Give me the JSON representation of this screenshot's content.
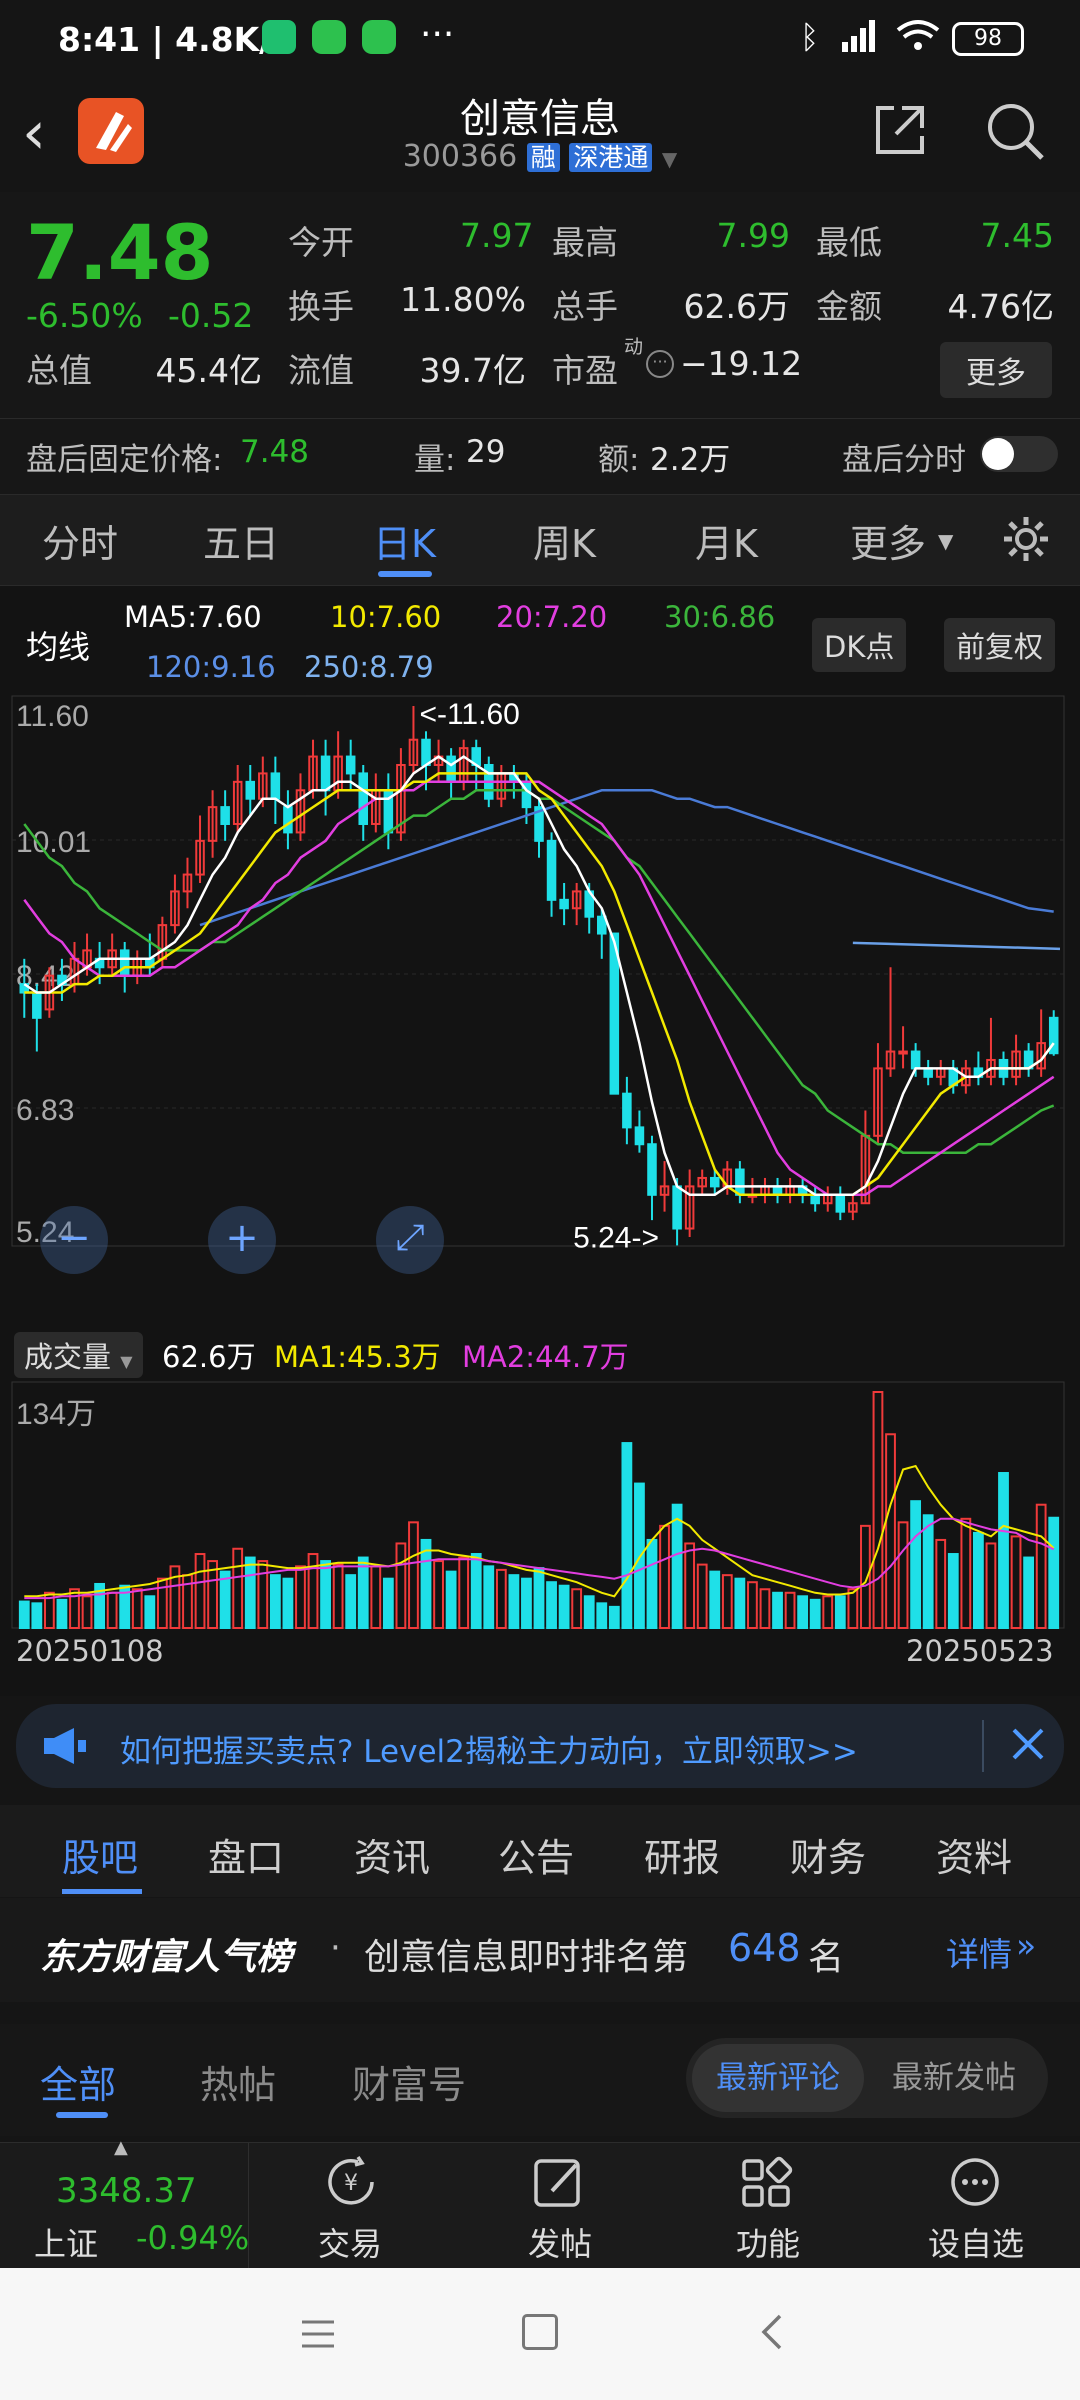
{
  "status_bar": {
    "time_speed": "8:41 | 4.8K/s",
    "dots": "···",
    "battery": "98"
  },
  "header": {
    "title": "创意信息",
    "code": "300366",
    "badge_rong": "融",
    "badge_sgt": "深港通"
  },
  "quote": {
    "price": "7.48",
    "change_pct": "-6.50%",
    "change_amt": "-0.52",
    "rows": [
      [
        {
          "k": "今开",
          "v": "7.97",
          "c": "green"
        },
        {
          "k": "最高",
          "v": "7.99",
          "c": "green"
        },
        {
          "k": "最低",
          "v": "7.45",
          "c": "green"
        }
      ],
      [
        {
          "k": "换手",
          "v": "11.80%",
          "c": "white"
        },
        {
          "k": "总手",
          "v": "62.6万",
          "c": "white"
        },
        {
          "k": "金额",
          "v": "4.76亿",
          "c": "white"
        }
      ]
    ],
    "total_value_label": "总值",
    "total_value": "45.4亿",
    "float_value_label": "流值",
    "float_value": "39.7亿",
    "pe_label": "市盈",
    "pe_sup": "动",
    "pe_value": "−19.12",
    "more_button": "更多",
    "after_label": "盘后固定价格:",
    "after_price": "7.48",
    "after_vol_label": "量:",
    "after_vol": "29",
    "after_amt_label": "额:",
    "after_amt": "2.2万",
    "after_intraday": "盘后分时"
  },
  "period_tabs": [
    "分时",
    "五日",
    "日K",
    "周K",
    "月K",
    "更多"
  ],
  "active_period": "日K",
  "ma": {
    "label": "均线",
    "ma5": "MA5:7.60",
    "ma10": "10:7.60",
    "ma20": "20:7.20",
    "ma30": "30:6.86",
    "ma120": "120:9.16",
    "ma250": "250:8.79",
    "dk_button": "DK点",
    "fq_button": "前复权"
  },
  "chart_data": [
    {
      "type": "candlestick",
      "y_ticks": [
        "11.60",
        "10.01",
        "8.42",
        "6.83",
        "5.24"
      ],
      "ylim": [
        5.24,
        11.6
      ],
      "high_label": "<-11.60",
      "low_label": "5.24->",
      "colors": {
        "up": "#f03a3a",
        "down": "#1fe0e8",
        "ma5": "#ffffff",
        "ma10": "#f2e900",
        "ma20": "#e23ee0",
        "ma30": "#3bb53b",
        "ma120": "#4a7bd6",
        "ma250": "#6aa0e8"
      },
      "ohlc": [
        [
          8.3,
          8.2,
          8.6,
          7.9
        ],
        [
          8.2,
          7.9,
          8.3,
          7.5
        ],
        [
          8.0,
          8.4,
          8.5,
          7.9
        ],
        [
          8.4,
          8.3,
          8.6,
          8.1
        ],
        [
          8.3,
          8.6,
          8.8,
          8.2
        ],
        [
          8.5,
          8.7,
          8.9,
          8.4
        ],
        [
          8.6,
          8.5,
          8.8,
          8.3
        ],
        [
          8.5,
          8.7,
          8.9,
          8.4
        ],
        [
          8.7,
          8.4,
          8.8,
          8.2
        ],
        [
          8.4,
          8.6,
          8.7,
          8.3
        ],
        [
          8.6,
          8.5,
          8.9,
          8.4
        ],
        [
          8.6,
          9.0,
          9.1,
          8.5
        ],
        [
          9.0,
          9.4,
          9.6,
          8.9
        ],
        [
          9.4,
          9.6,
          9.8,
          9.2
        ],
        [
          9.6,
          10.0,
          10.3,
          9.5
        ],
        [
          10.0,
          10.4,
          10.6,
          9.8
        ],
        [
          10.4,
          10.2,
          10.6,
          10.0
        ],
        [
          10.2,
          10.7,
          10.9,
          10.1
        ],
        [
          10.7,
          10.5,
          10.9,
          10.3
        ],
        [
          10.5,
          10.8,
          11.0,
          10.4
        ],
        [
          10.8,
          10.5,
          11.0,
          10.2
        ],
        [
          10.4,
          10.1,
          10.6,
          9.9
        ],
        [
          10.1,
          10.6,
          10.8,
          10.0
        ],
        [
          10.6,
          11.0,
          11.2,
          10.5
        ],
        [
          11.0,
          10.6,
          11.2,
          10.3
        ],
        [
          10.6,
          11.0,
          11.3,
          10.5
        ],
        [
          11.0,
          10.8,
          11.2,
          10.6
        ],
        [
          10.8,
          10.2,
          10.9,
          10.0
        ],
        [
          10.2,
          10.6,
          10.8,
          10.1
        ],
        [
          10.6,
          10.1,
          10.8,
          9.9
        ],
        [
          10.1,
          10.9,
          11.1,
          10.0
        ],
        [
          10.9,
          11.2,
          11.6,
          10.8
        ],
        [
          11.2,
          10.9,
          11.3,
          10.6
        ],
        [
          10.9,
          11.0,
          11.2,
          10.7
        ],
        [
          11.0,
          10.7,
          11.1,
          10.5
        ],
        [
          10.7,
          11.1,
          11.2,
          10.6
        ],
        [
          11.1,
          10.9,
          11.2,
          10.6
        ],
        [
          10.9,
          10.5,
          11.0,
          10.4
        ],
        [
          10.5,
          10.8,
          10.9,
          10.4
        ],
        [
          10.8,
          10.7,
          10.9,
          10.5
        ],
        [
          10.7,
          10.4,
          10.8,
          10.2
        ],
        [
          10.4,
          10.0,
          10.5,
          9.8
        ],
        [
          10.0,
          9.3,
          10.1,
          9.1
        ],
        [
          9.3,
          9.2,
          9.5,
          9.0
        ],
        [
          9.2,
          9.4,
          9.5,
          9.0
        ],
        [
          9.4,
          9.1,
          9.5,
          8.9
        ],
        [
          9.1,
          8.9,
          9.2,
          8.6
        ],
        [
          8.9,
          7.0,
          8.9,
          7.0
        ],
        [
          7.0,
          6.6,
          7.2,
          6.4
        ],
        [
          6.6,
          6.4,
          6.8,
          6.3
        ],
        [
          6.4,
          5.8,
          6.5,
          5.5
        ],
        [
          5.8,
          5.9,
          6.2,
          5.6
        ],
        [
          5.9,
          5.4,
          6.0,
          5.2
        ],
        [
          5.4,
          5.9,
          6.1,
          5.3
        ],
        [
          5.9,
          6.0,
          6.1,
          5.8
        ],
        [
          6.0,
          5.9,
          6.1,
          5.8
        ],
        [
          5.9,
          6.1,
          6.2,
          5.8
        ],
        [
          6.1,
          5.8,
          6.2,
          5.7
        ],
        [
          5.8,
          5.8,
          6.0,
          5.7
        ],
        [
          5.8,
          5.9,
          6.0,
          5.7
        ],
        [
          5.9,
          5.8,
          6.0,
          5.7
        ],
        [
          5.8,
          5.9,
          6.0,
          5.7
        ],
        [
          5.9,
          5.8,
          6.0,
          5.7
        ],
        [
          5.8,
          5.7,
          5.9,
          5.6
        ],
        [
          5.7,
          5.8,
          5.9,
          5.6
        ],
        [
          5.8,
          5.6,
          5.9,
          5.5
        ],
        [
          5.6,
          5.7,
          5.8,
          5.5
        ],
        [
          5.7,
          6.5,
          6.8,
          5.7
        ],
        [
          6.5,
          7.3,
          7.6,
          6.4
        ],
        [
          7.3,
          7.5,
          8.5,
          7.2
        ],
        [
          7.5,
          7.5,
          7.8,
          7.3
        ],
        [
          7.5,
          7.3,
          7.6,
          7.2
        ],
        [
          7.3,
          7.2,
          7.4,
          7.1
        ],
        [
          7.2,
          7.3,
          7.4,
          7.1
        ],
        [
          7.3,
          7.1,
          7.4,
          7.0
        ],
        [
          7.1,
          7.3,
          7.4,
          7.0
        ],
        [
          7.3,
          7.2,
          7.5,
          7.1
        ],
        [
          7.2,
          7.4,
          7.9,
          7.1
        ],
        [
          7.4,
          7.2,
          7.5,
          7.1
        ],
        [
          7.2,
          7.5,
          7.7,
          7.1
        ],
        [
          7.5,
          7.3,
          7.6,
          7.2
        ],
        [
          7.3,
          7.6,
          8.0,
          7.2
        ],
        [
          7.9,
          7.48,
          7.99,
          7.45
        ]
      ],
      "ma_lines": {
        "ma5": [
          8.3,
          8.2,
          8.2,
          8.3,
          8.4,
          8.5,
          8.6,
          8.6,
          8.6,
          8.6,
          8.6,
          8.7,
          8.8,
          9.0,
          9.3,
          9.6,
          9.8,
          10.1,
          10.3,
          10.5,
          10.5,
          10.4,
          10.5,
          10.6,
          10.6,
          10.7,
          10.7,
          10.6,
          10.5,
          10.5,
          10.6,
          10.8,
          10.9,
          11.0,
          10.9,
          11.0,
          10.9,
          10.8,
          10.8,
          10.8,
          10.6,
          10.5,
          10.2,
          9.9,
          9.7,
          9.4,
          9.2,
          8.8,
          8.2,
          7.6,
          6.9,
          6.3,
          5.9,
          5.8,
          5.8,
          5.8,
          5.9,
          5.9,
          5.9,
          5.9,
          5.9,
          5.9,
          5.9,
          5.8,
          5.8,
          5.8,
          5.8,
          5.9,
          6.2,
          6.6,
          7.0,
          7.3,
          7.3,
          7.3,
          7.3,
          7.2,
          7.2,
          7.3,
          7.3,
          7.3,
          7.3,
          7.4,
          7.6
        ],
        "ma10": [
          8.2,
          8.2,
          8.2,
          8.2,
          8.3,
          8.3,
          8.4,
          8.4,
          8.5,
          8.5,
          8.5,
          8.6,
          8.7,
          8.8,
          8.9,
          9.1,
          9.3,
          9.5,
          9.7,
          9.9,
          10.1,
          10.2,
          10.3,
          10.4,
          10.5,
          10.6,
          10.6,
          10.6,
          10.6,
          10.6,
          10.6,
          10.7,
          10.7,
          10.8,
          10.8,
          10.8,
          10.8,
          10.8,
          10.8,
          10.8,
          10.8,
          10.6,
          10.5,
          10.3,
          10.1,
          9.9,
          9.7,
          9.4,
          9.0,
          8.6,
          8.2,
          7.8,
          7.4,
          6.9,
          6.5,
          6.1,
          5.9,
          5.8,
          5.8,
          5.8,
          5.8,
          5.8,
          5.8,
          5.8,
          5.8,
          5.8,
          5.8,
          5.9,
          6.0,
          6.2,
          6.4,
          6.6,
          6.8,
          7.0,
          7.1,
          7.2,
          7.2,
          7.3,
          7.3,
          7.3,
          7.3,
          7.4,
          7.6
        ],
        "ma20": [
          9.3,
          9.1,
          8.9,
          8.8,
          8.6,
          8.5,
          8.4,
          8.4,
          8.4,
          8.4,
          8.4,
          8.5,
          8.5,
          8.6,
          8.7,
          8.8,
          8.9,
          9.0,
          9.2,
          9.3,
          9.5,
          9.6,
          9.8,
          9.9,
          10.0,
          10.2,
          10.3,
          10.4,
          10.5,
          10.5,
          10.6,
          10.6,
          10.7,
          10.7,
          10.7,
          10.7,
          10.7,
          10.7,
          10.7,
          10.7,
          10.7,
          10.7,
          10.6,
          10.5,
          10.4,
          10.3,
          10.2,
          10.0,
          9.8,
          9.6,
          9.3,
          9.0,
          8.7,
          8.4,
          8.1,
          7.8,
          7.5,
          7.2,
          6.9,
          6.6,
          6.3,
          6.1,
          6.0,
          5.9,
          5.8,
          5.8,
          5.8,
          5.8,
          5.9,
          5.9,
          6.0,
          6.1,
          6.2,
          6.3,
          6.4,
          6.5,
          6.6,
          6.7,
          6.8,
          6.9,
          7.0,
          7.1,
          7.2
        ],
        "ma30": [
          10.2,
          10.0,
          9.8,
          9.7,
          9.5,
          9.4,
          9.2,
          9.1,
          9.0,
          8.9,
          8.8,
          8.7,
          8.7,
          8.7,
          8.7,
          8.8,
          8.8,
          8.9,
          9.0,
          9.1,
          9.2,
          9.3,
          9.4,
          9.5,
          9.6,
          9.7,
          9.8,
          9.9,
          10.0,
          10.1,
          10.2,
          10.3,
          10.3,
          10.4,
          10.5,
          10.5,
          10.6,
          10.6,
          10.6,
          10.6,
          10.6,
          10.5,
          10.5,
          10.4,
          10.3,
          10.2,
          10.1,
          10.0,
          9.8,
          9.7,
          9.5,
          9.3,
          9.1,
          8.9,
          8.7,
          8.5,
          8.3,
          8.1,
          7.9,
          7.7,
          7.5,
          7.3,
          7.1,
          7.0,
          6.8,
          6.7,
          6.6,
          6.5,
          6.4,
          6.4,
          6.3,
          6.3,
          6.3,
          6.3,
          6.3,
          6.3,
          6.4,
          6.4,
          6.5,
          6.6,
          6.7,
          6.8,
          6.86
        ],
        "ma120": [
          9.0,
          9.05,
          9.1,
          9.15,
          9.2,
          9.25,
          9.3,
          9.35,
          9.4,
          9.45,
          9.5,
          9.55,
          9.6,
          9.65,
          9.7,
          9.75,
          9.8,
          9.85,
          9.9,
          9.95,
          10.0,
          10.05,
          10.1,
          10.15,
          10.2,
          10.25,
          10.3,
          10.35,
          10.4,
          10.45,
          10.5,
          10.55,
          10.6,
          10.6,
          10.6,
          10.6,
          10.6,
          10.55,
          10.5,
          10.5,
          10.45,
          10.4,
          10.4,
          10.35,
          10.3,
          10.25,
          10.2,
          10.15,
          10.1,
          10.05,
          10.0,
          9.95,
          9.9,
          9.85,
          9.8,
          9.75,
          9.7,
          9.65,
          9.6,
          9.55,
          9.5,
          9.45,
          9.4,
          9.35,
          9.3,
          9.25,
          9.2,
          9.18,
          9.16
        ],
        "ma250_flat": 8.79
      }
    },
    {
      "type": "bar",
      "title": "成交量",
      "value": "62.6万",
      "ma1": "MA1:45.3万",
      "ma2": "MA2:44.7万",
      "y_max_label": "134万",
      "ylim": [
        0,
        134
      ],
      "start_date": "20250108",
      "end_date": "20250523",
      "volumes": [
        15,
        14,
        20,
        16,
        22,
        18,
        25,
        20,
        24,
        22,
        18,
        28,
        35,
        30,
        42,
        38,
        32,
        45,
        40,
        38,
        30,
        28,
        35,
        42,
        38,
        36,
        30,
        40,
        35,
        28,
        48,
        60,
        50,
        38,
        32,
        40,
        42,
        35,
        33,
        30,
        28,
        34,
        26,
        24,
        22,
        18,
        14,
        12,
        105,
        82,
        50,
        58,
        70,
        48,
        36,
        32,
        30,
        28,
        26,
        22,
        20,
        20,
        18,
        16,
        18,
        18,
        22,
        58,
        134,
        110,
        60,
        72,
        64,
        50,
        42,
        62,
        54,
        48,
        88,
        52,
        40,
        70,
        62.6
      ],
      "ma1_line": [
        18,
        18,
        19,
        19,
        20,
        20,
        21,
        22,
        23,
        24,
        25,
        27,
        29,
        30,
        32,
        33,
        34,
        35,
        36,
        36,
        35,
        34,
        34,
        35,
        36,
        37,
        37,
        37,
        36,
        35,
        37,
        41,
        44,
        44,
        42,
        41,
        40,
        38,
        37,
        35,
        33,
        32,
        30,
        28,
        26,
        23,
        20,
        18,
        28,
        40,
        50,
        58,
        62,
        58,
        50,
        45,
        40,
        35,
        30,
        28,
        26,
        24,
        22,
        20,
        19,
        19,
        20,
        26,
        45,
        70,
        90,
        92,
        80,
        70,
        62,
        58,
        55,
        52,
        58,
        56,
        54,
        52,
        45.3
      ],
      "ma2_line": [
        17,
        17,
        17,
        18,
        18,
        19,
        19,
        20,
        20,
        21,
        22,
        23,
        24,
        25,
        26,
        27,
        28,
        29,
        30,
        31,
        32,
        33,
        33,
        34,
        34,
        35,
        35,
        35,
        35,
        35,
        36,
        37,
        38,
        39,
        39,
        39,
        39,
        38,
        37,
        36,
        35,
        34,
        33,
        32,
        31,
        30,
        29,
        28,
        30,
        33,
        36,
        39,
        42,
        44,
        45,
        44,
        42,
        40,
        38,
        36,
        34,
        32,
        30,
        28,
        26,
        24,
        23,
        24,
        28,
        35,
        44,
        52,
        58,
        62,
        62,
        60,
        58,
        56,
        55,
        54,
        50,
        48,
        44.7
      ]
    }
  ],
  "chart_controls": {
    "minus": "−",
    "plus": "+",
    "expand": "⤢"
  },
  "vol_selector": "成交量",
  "banner": {
    "text": "如何把握买卖点? Level2揭秘主力动向，立即领取>>"
  },
  "section_tabs": [
    "股吧",
    "盘口",
    "资讯",
    "公告",
    "研报",
    "财务",
    "资料"
  ],
  "active_section": "股吧",
  "rank": {
    "brand": "东方财富人气榜",
    "sep": "·",
    "text_before": "创意信息即时排名第",
    "number": "648",
    "text_after": "名",
    "detail": "详情"
  },
  "post_filters": {
    "tabs": [
      "全部",
      "热帖",
      "财富号"
    ],
    "active": "全部",
    "sort_options": [
      "最新评论",
      "最新发帖"
    ],
    "active_sort": "最新评论"
  },
  "bottom_bar": {
    "index_value": "3348.37",
    "index_name": "上证",
    "index_change": "-0.94%",
    "items": [
      "交易",
      "发帖",
      "功能",
      "设自选"
    ]
  }
}
